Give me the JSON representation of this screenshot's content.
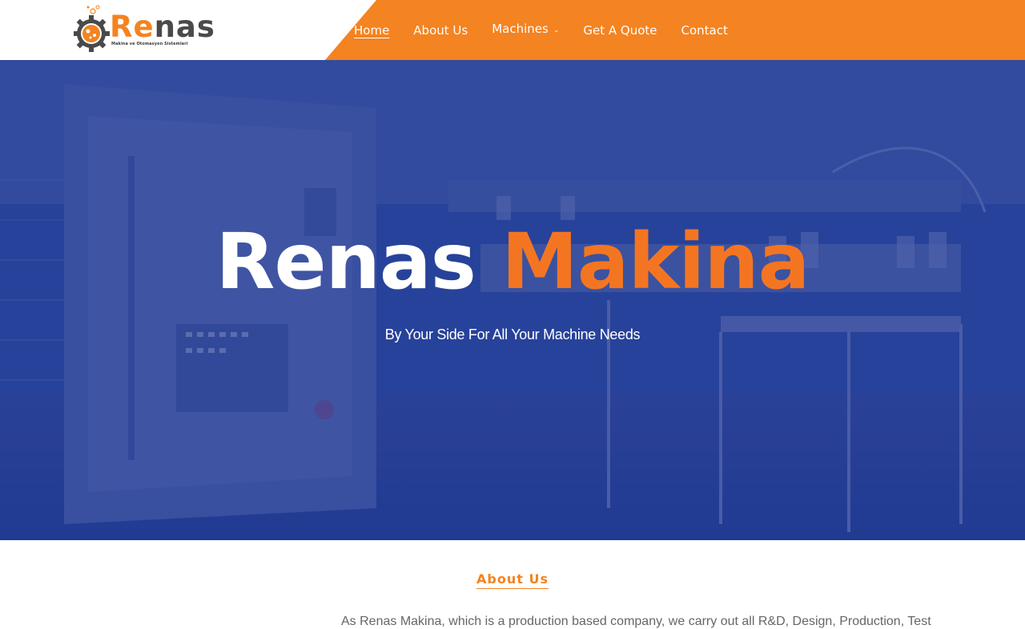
{
  "logo": {
    "prefix": "Re",
    "suffix": "nas",
    "tagline": "Makina ve Otomasyon Sistemleri",
    "icon": "gear-flask-icon"
  },
  "nav": {
    "items": [
      {
        "label": "Home",
        "active": true
      },
      {
        "label": "About Us"
      },
      {
        "label": "Machines",
        "has_dropdown": true
      },
      {
        "label": "Get A Quote"
      },
      {
        "label": "Contact"
      }
    ],
    "dropdown_icon": "chevron-down-icon"
  },
  "hero": {
    "title_white": "Renas",
    "title_accent": "Makina",
    "subtitle": "By Your Side For All Your Machine Needs"
  },
  "about": {
    "heading": "About Us",
    "text": "As Renas Makina, which is a production based company, we carry out all R&D, Design, Production, Test"
  },
  "colors": {
    "accent": "#f48321",
    "hero_overlay": "#1e3796",
    "white": "#ffffff",
    "body_text": "#666666"
  }
}
